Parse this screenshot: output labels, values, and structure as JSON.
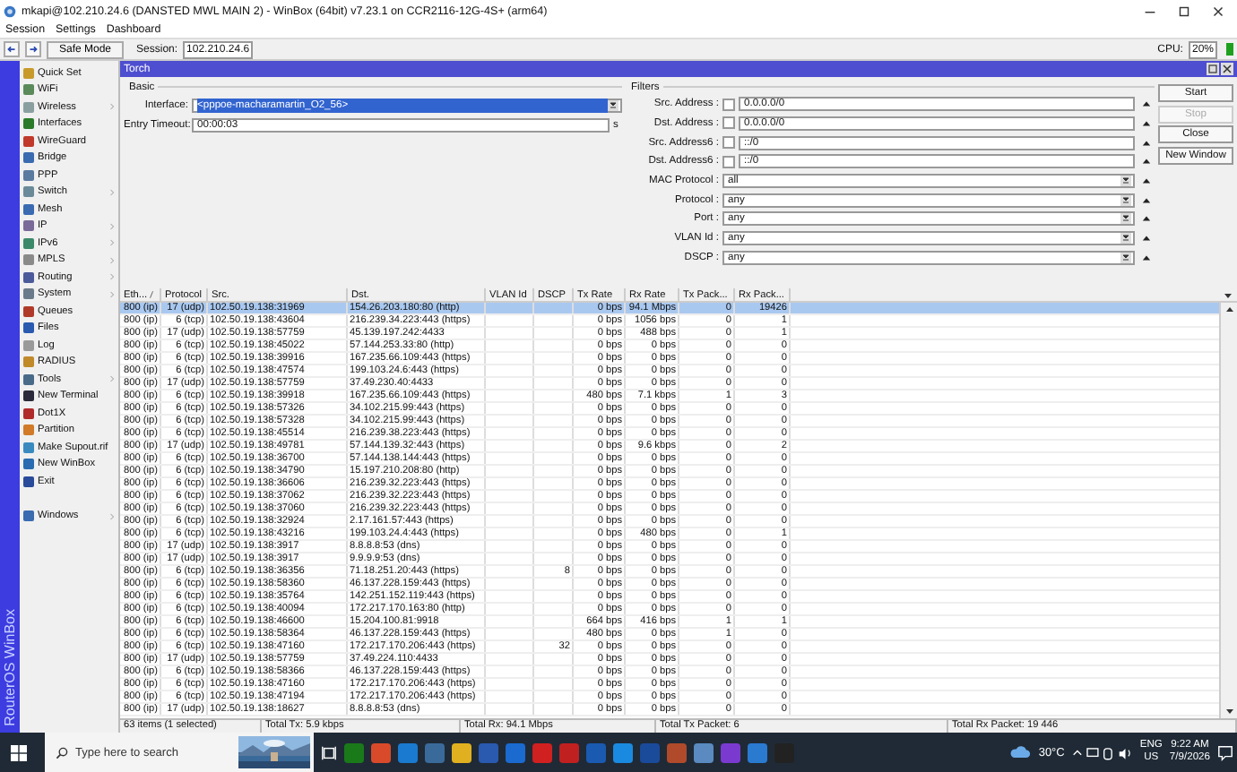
{
  "window": {
    "title": "mkapi@102.210.24.6 (DANSTED MWL MAIN 2) - WinBox (64bit) v7.23.1 on CCR2116-12G-4S+ (arm64)"
  },
  "menu": [
    "Session",
    "Settings",
    "Dashboard"
  ],
  "toolbar": {
    "safe_mode": "Safe Mode",
    "session_label": "Session:",
    "session": "102.210.24.6",
    "cpu_label": "CPU:",
    "cpu": "20%"
  },
  "sidebar": {
    "brand": "RouterOS WinBox",
    "items": [
      {
        "label": "Quick Set",
        "submenu": false
      },
      {
        "label": "WiFi",
        "submenu": false
      },
      {
        "label": "Wireless",
        "submenu": true
      },
      {
        "label": "Interfaces",
        "submenu": false
      },
      {
        "label": "WireGuard",
        "submenu": false
      },
      {
        "label": "Bridge",
        "submenu": false
      },
      {
        "label": "PPP",
        "submenu": false
      },
      {
        "label": "Switch",
        "submenu": true
      },
      {
        "label": "Mesh",
        "submenu": false
      },
      {
        "label": "IP",
        "submenu": true
      },
      {
        "label": "IPv6",
        "submenu": true
      },
      {
        "label": "MPLS",
        "submenu": true
      },
      {
        "label": "Routing",
        "submenu": true
      },
      {
        "label": "System",
        "submenu": true
      },
      {
        "label": "Queues",
        "submenu": false
      },
      {
        "label": "Files",
        "submenu": false
      },
      {
        "label": "Log",
        "submenu": false
      },
      {
        "label": "RADIUS",
        "submenu": false
      },
      {
        "label": "Tools",
        "submenu": true
      },
      {
        "label": "New Terminal",
        "submenu": false
      },
      {
        "label": "Dot1X",
        "submenu": false
      },
      {
        "label": "Partition",
        "submenu": false
      },
      {
        "label": "Make Supout.rif",
        "submenu": false
      },
      {
        "label": "New WinBox",
        "submenu": false
      },
      {
        "label": "Exit",
        "submenu": false
      }
    ],
    "bottom_items": [
      {
        "label": "Windows",
        "submenu": true
      }
    ]
  },
  "torch": {
    "title": "Torch",
    "basic": {
      "legend": "Basic",
      "interface_label": "Interface:",
      "interface": "<pppoe-macharamartin_O2_56>",
      "timeout_label": "Entry Timeout:",
      "timeout": "00:00:03",
      "timeout_unit": "s"
    },
    "filters": {
      "legend": "Filters",
      "rows": [
        {
          "kind": "address",
          "label": "Src. Address :",
          "checked": false,
          "value": "0.0.0.0/0"
        },
        {
          "kind": "address",
          "label": "Dst. Address :",
          "checked": false,
          "value": "0.0.0.0/0"
        },
        {
          "kind": "address",
          "label": "Src. Address6 :",
          "checked": false,
          "value": "::/0"
        },
        {
          "kind": "address",
          "label": "Dst. Address6 :",
          "checked": false,
          "value": "::/0"
        },
        {
          "kind": "dropdown",
          "label": "MAC Protocol :",
          "value": "all"
        },
        {
          "kind": "dropdown",
          "label": "Protocol :",
          "value": "any"
        },
        {
          "kind": "dropdown",
          "label": "Port :",
          "value": "any"
        },
        {
          "kind": "dropdown",
          "label": "VLAN Id :",
          "value": "any"
        },
        {
          "kind": "dropdown",
          "label": "DSCP :",
          "value": "any"
        }
      ]
    },
    "buttons": [
      {
        "label": "Start",
        "disabled": false
      },
      {
        "label": "Stop",
        "disabled": true
      },
      {
        "label": "Close",
        "disabled": false
      },
      {
        "label": "New Window",
        "disabled": false
      }
    ]
  },
  "table": {
    "columns": [
      {
        "label": "Eth...",
        "sorted": true
      },
      {
        "label": "Protocol",
        "sorted": false
      },
      {
        "label": "Src.",
        "sorted": false
      },
      {
        "label": "Dst.",
        "sorted": false
      },
      {
        "label": "VLAN Id",
        "sorted": false
      },
      {
        "label": "DSCP",
        "sorted": false
      },
      {
        "label": "Tx Rate",
        "sorted": false
      },
      {
        "label": "Rx Rate",
        "sorted": false
      },
      {
        "label": "Tx Pack...",
        "sorted": false
      },
      {
        "label": "Rx Pack...",
        "sorted": false
      }
    ],
    "rows": [
      {
        "selected": true,
        "eth": "800 (ip)",
        "protocol": "17 (udp)",
        "src": "102.50.19.138:31969",
        "dst": "154.26.203.180:80 (http)",
        "tx_rate": "0 bps",
        "rx_rate": "94.1 Mbps",
        "tx_packets": "0",
        "rx_packets": "19426"
      },
      {
        "selected": false,
        "eth": "800 (ip)",
        "protocol": "6 (tcp)",
        "src": "102.50.19.138:43604",
        "dst": "216.239.34.223:443 (https)",
        "tx_rate": "0 bps",
        "rx_rate": "1056 bps",
        "tx_packets": "0",
        "rx_packets": "1"
      },
      {
        "selected": false,
        "eth": "800 (ip)",
        "protocol": "17 (udp)",
        "src": "102.50.19.138:57759",
        "dst": "45.139.197.242:4433",
        "tx_rate": "0 bps",
        "rx_rate": "488 bps",
        "tx_packets": "0",
        "rx_packets": "1"
      },
      {
        "selected": false,
        "eth": "800 (ip)",
        "protocol": "6 (tcp)",
        "src": "102.50.19.138:45022",
        "dst": "57.144.253.33:80 (http)",
        "tx_rate": "0 bps",
        "rx_rate": "0 bps",
        "tx_packets": "0",
        "rx_packets": "0"
      },
      {
        "selected": false,
        "eth": "800 (ip)",
        "protocol": "6 (tcp)",
        "src": "102.50.19.138:39916",
        "dst": "167.235.66.109:443 (https)",
        "tx_rate": "0 bps",
        "rx_rate": "0 bps",
        "tx_packets": "0",
        "rx_packets": "0"
      },
      {
        "selected": false,
        "eth": "800 (ip)",
        "protocol": "6 (tcp)",
        "src": "102.50.19.138:47574",
        "dst": "199.103.24.6:443 (https)",
        "tx_rate": "0 bps",
        "rx_rate": "0 bps",
        "tx_packets": "0",
        "rx_packets": "0"
      },
      {
        "selected": false,
        "eth": "800 (ip)",
        "protocol": "17 (udp)",
        "src": "102.50.19.138:57759",
        "dst": "37.49.230.40:4433",
        "tx_rate": "0 bps",
        "rx_rate": "0 bps",
        "tx_packets": "0",
        "rx_packets": "0"
      },
      {
        "selected": false,
        "eth": "800 (ip)",
        "protocol": "6 (tcp)",
        "src": "102.50.19.138:39918",
        "dst": "167.235.66.109:443 (https)",
        "tx_rate": "480 bps",
        "rx_rate": "7.1 kbps",
        "tx_packets": "1",
        "rx_packets": "3"
      },
      {
        "selected": false,
        "eth": "800 (ip)",
        "protocol": "6 (tcp)",
        "src": "102.50.19.138:57326",
        "dst": "34.102.215.99:443 (https)",
        "tx_rate": "0 bps",
        "rx_rate": "0 bps",
        "tx_packets": "0",
        "rx_packets": "0"
      },
      {
        "selected": false,
        "eth": "800 (ip)",
        "protocol": "6 (tcp)",
        "src": "102.50.19.138:57328",
        "dst": "34.102.215.99:443 (https)",
        "tx_rate": "0 bps",
        "rx_rate": "0 bps",
        "tx_packets": "0",
        "rx_packets": "0"
      },
      {
        "selected": false,
        "eth": "800 (ip)",
        "protocol": "6 (tcp)",
        "src": "102.50.19.138:45514",
        "dst": "216.239.38.223:443 (https)",
        "tx_rate": "0 bps",
        "rx_rate": "0 bps",
        "tx_packets": "0",
        "rx_packets": "0"
      },
      {
        "selected": false,
        "eth": "800 (ip)",
        "protocol": "17 (udp)",
        "src": "102.50.19.138:49781",
        "dst": "57.144.139.32:443 (https)",
        "tx_rate": "0 bps",
        "rx_rate": "9.6 kbps",
        "tx_packets": "0",
        "rx_packets": "2"
      },
      {
        "selected": false,
        "eth": "800 (ip)",
        "protocol": "6 (tcp)",
        "src": "102.50.19.138:36700",
        "dst": "57.144.138.144:443 (https)",
        "tx_rate": "0 bps",
        "rx_rate": "0 bps",
        "tx_packets": "0",
        "rx_packets": "0"
      },
      {
        "selected": false,
        "eth": "800 (ip)",
        "protocol": "6 (tcp)",
        "src": "102.50.19.138:34790",
        "dst": "15.197.210.208:80 (http)",
        "tx_rate": "0 bps",
        "rx_rate": "0 bps",
        "tx_packets": "0",
        "rx_packets": "0"
      },
      {
        "selected": false,
        "eth": "800 (ip)",
        "protocol": "6 (tcp)",
        "src": "102.50.19.138:36606",
        "dst": "216.239.32.223:443 (https)",
        "tx_rate": "0 bps",
        "rx_rate": "0 bps",
        "tx_packets": "0",
        "rx_packets": "0"
      },
      {
        "selected": false,
        "eth": "800 (ip)",
        "protocol": "6 (tcp)",
        "src": "102.50.19.138:37062",
        "dst": "216.239.32.223:443 (https)",
        "tx_rate": "0 bps",
        "rx_rate": "0 bps",
        "tx_packets": "0",
        "rx_packets": "0"
      },
      {
        "selected": false,
        "eth": "800 (ip)",
        "protocol": "6 (tcp)",
        "src": "102.50.19.138:37060",
        "dst": "216.239.32.223:443 (https)",
        "tx_rate": "0 bps",
        "rx_rate": "0 bps",
        "tx_packets": "0",
        "rx_packets": "0"
      },
      {
        "selected": false,
        "eth": "800 (ip)",
        "protocol": "6 (tcp)",
        "src": "102.50.19.138:32924",
        "dst": "2.17.161.57:443 (https)",
        "tx_rate": "0 bps",
        "rx_rate": "0 bps",
        "tx_packets": "0",
        "rx_packets": "0"
      },
      {
        "selected": false,
        "eth": "800 (ip)",
        "protocol": "6 (tcp)",
        "src": "102.50.19.138:43216",
        "dst": "199.103.24.4:443 (https)",
        "tx_rate": "0 bps",
        "rx_rate": "480 bps",
        "tx_packets": "0",
        "rx_packets": "1"
      },
      {
        "selected": false,
        "eth": "800 (ip)",
        "protocol": "17 (udp)",
        "src": "102.50.19.138:3917",
        "dst": "8.8.8.8:53 (dns)",
        "tx_rate": "0 bps",
        "rx_rate": "0 bps",
        "tx_packets": "0",
        "rx_packets": "0"
      },
      {
        "selected": false,
        "eth": "800 (ip)",
        "protocol": "17 (udp)",
        "src": "102.50.19.138:3917",
        "dst": "9.9.9.9:53 (dns)",
        "tx_rate": "0 bps",
        "rx_rate": "0 bps",
        "tx_packets": "0",
        "rx_packets": "0"
      },
      {
        "selected": false,
        "eth": "800 (ip)",
        "protocol": "6 (tcp)",
        "src": "102.50.19.138:36356",
        "dst": "71.18.251.20:443 (https)",
        "dscp": "8",
        "tx_rate": "0 bps",
        "rx_rate": "0 bps",
        "tx_packets": "0",
        "rx_packets": "0"
      },
      {
        "selected": false,
        "eth": "800 (ip)",
        "protocol": "6 (tcp)",
        "src": "102.50.19.138:58360",
        "dst": "46.137.228.159:443 (https)",
        "tx_rate": "0 bps",
        "rx_rate": "0 bps",
        "tx_packets": "0",
        "rx_packets": "0"
      },
      {
        "selected": false,
        "eth": "800 (ip)",
        "protocol": "6 (tcp)",
        "src": "102.50.19.138:35764",
        "dst": "142.251.152.119:443 (https)",
        "tx_rate": "0 bps",
        "rx_rate": "0 bps",
        "tx_packets": "0",
        "rx_packets": "0"
      },
      {
        "selected": false,
        "eth": "800 (ip)",
        "protocol": "6 (tcp)",
        "src": "102.50.19.138:40094",
        "dst": "172.217.170.163:80 (http)",
        "tx_rate": "0 bps",
        "rx_rate": "0 bps",
        "tx_packets": "0",
        "rx_packets": "0"
      },
      {
        "selected": false,
        "eth": "800 (ip)",
        "protocol": "6 (tcp)",
        "src": "102.50.19.138:46600",
        "dst": "15.204.100.81:9918",
        "tx_rate": "664 bps",
        "rx_rate": "416 bps",
        "tx_packets": "1",
        "rx_packets": "1"
      },
      {
        "selected": false,
        "eth": "800 (ip)",
        "protocol": "6 (tcp)",
        "src": "102.50.19.138:58364",
        "dst": "46.137.228.159:443 (https)",
        "tx_rate": "480 bps",
        "rx_rate": "0 bps",
        "tx_packets": "1",
        "rx_packets": "0"
      },
      {
        "selected": false,
        "eth": "800 (ip)",
        "protocol": "6 (tcp)",
        "src": "102.50.19.138:47160",
        "dst": "172.217.170.206:443 (https)",
        "dscp": "32",
        "tx_rate": "0 bps",
        "rx_rate": "0 bps",
        "tx_packets": "0",
        "rx_packets": "0"
      },
      {
        "selected": false,
        "eth": "800 (ip)",
        "protocol": "17 (udp)",
        "src": "102.50.19.138:57759",
        "dst": "37.49.224.110:4433",
        "tx_rate": "0 bps",
        "rx_rate": "0 bps",
        "tx_packets": "0",
        "rx_packets": "0"
      },
      {
        "selected": false,
        "eth": "800 (ip)",
        "protocol": "6 (tcp)",
        "src": "102.50.19.138:58366",
        "dst": "46.137.228.159:443 (https)",
        "tx_rate": "0 bps",
        "rx_rate": "0 bps",
        "tx_packets": "0",
        "rx_packets": "0"
      },
      {
        "selected": false,
        "eth": "800 (ip)",
        "protocol": "6 (tcp)",
        "src": "102.50.19.138:47160",
        "dst": "172.217.170.206:443 (https)",
        "tx_rate": "0 bps",
        "rx_rate": "0 bps",
        "tx_packets": "0",
        "rx_packets": "0"
      },
      {
        "selected": false,
        "eth": "800 (ip)",
        "protocol": "6 (tcp)",
        "src": "102.50.19.138:47194",
        "dst": "172.217.170.206:443 (https)",
        "tx_rate": "0 bps",
        "rx_rate": "0 bps",
        "tx_packets": "0",
        "rx_packets": "0"
      },
      {
        "selected": false,
        "eth": "800 (ip)",
        "protocol": "17 (udp)",
        "src": "102.50.19.138:18627",
        "dst": "8.8.8.8:53 (dns)",
        "tx_rate": "0 bps",
        "rx_rate": "0 bps",
        "tx_packets": "0",
        "rx_packets": "0"
      }
    ],
    "status": [
      "63 items (1 selected)",
      "Total Tx: 5.9 kbps",
      "Total Rx: 94.1 Mbps",
      "Total Tx Packet: 6",
      "Total Rx Packet: 19 446"
    ]
  },
  "taskbar": {
    "search_placeholder": "Type here to search",
    "weather": "30°C",
    "language": "ENG",
    "region": "US",
    "time": "9:22 AM",
    "date": "7/9/2026"
  }
}
